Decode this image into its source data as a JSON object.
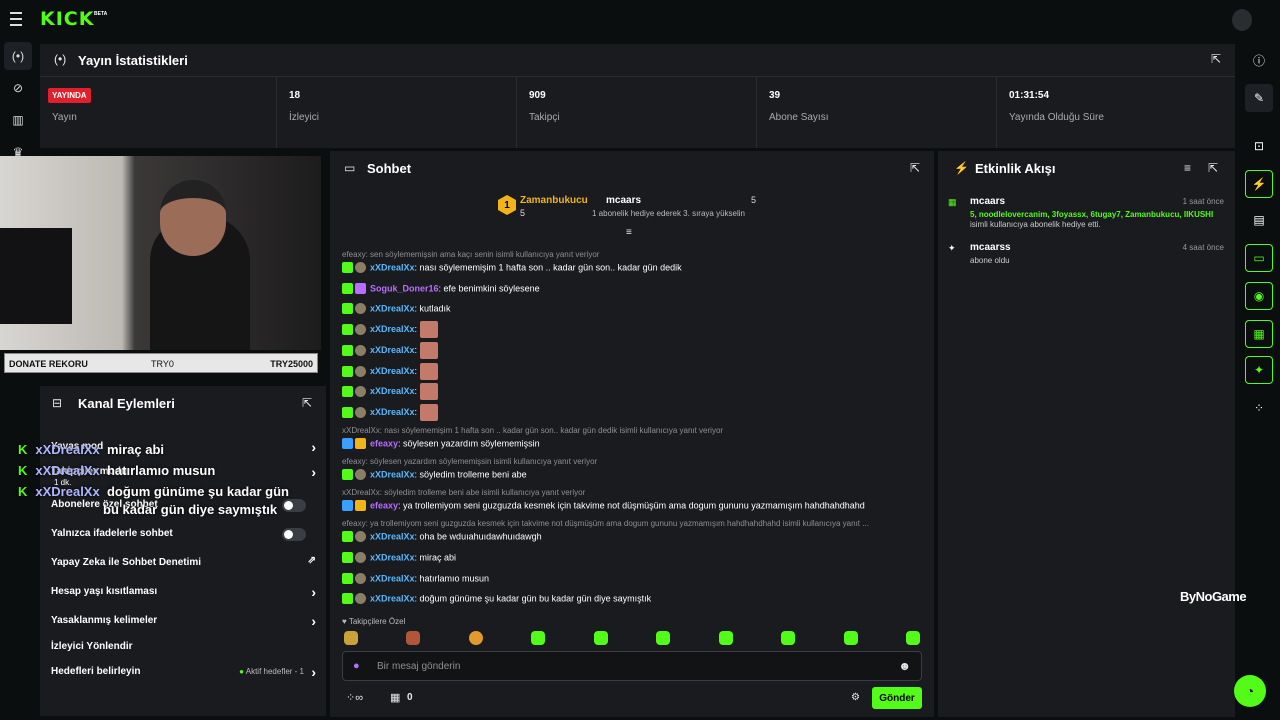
{
  "topbar": {
    "logo": "KICK",
    "beta": "BETA"
  },
  "stats": {
    "title": "Yayın İstatistikleri",
    "live_badge": "YAYINDA",
    "cells": [
      {
        "label": "Yayın"
      },
      {
        "value": "18",
        "label": "İzleyici"
      },
      {
        "value": "909",
        "label": "Takipçi"
      },
      {
        "value": "39",
        "label": "Abone Sayısı"
      },
      {
        "value": "01:31:54",
        "label": "Yayında Olduğu Süre"
      }
    ]
  },
  "donate": {
    "label": "DONATE REKORU",
    "mid": "TRY0",
    "value": "TRY25000"
  },
  "actions": {
    "title": "Kanal Eylemleri",
    "rows": [
      {
        "label": "Yavaş mod"
      },
      {
        "label": "Takipçiler modu"
      },
      {
        "label": "Abonelere özel sohbet"
      },
      {
        "label": "Yalnızca ifadelerle sohbet"
      },
      {
        "label": "Yapay Zeka ile Sohbet Denetimi"
      },
      {
        "label": "Hesap yaşı kısıtlaması"
      },
      {
        "label": "Yasaklanmış kelimeler"
      },
      {
        "label": "İzleyici Yönlendir"
      },
      {
        "label": "Hedefleri belirleyin",
        "status": "Aktif hedefler - 1"
      }
    ],
    "sub_note": "1 dk."
  },
  "overlay": [
    {
      "user": "xXDrealXx",
      "text": "miraç abi"
    },
    {
      "user": "xXDrealXx",
      "text": "hatırlamıo musun"
    },
    {
      "user": "xXDrealXx",
      "text": "doğum günüme şu kadar gün"
    },
    {
      "user": "",
      "text": "bu kadar gün diye saymıştık"
    }
  ],
  "chat": {
    "title": "Sohbet",
    "pinned": {
      "top_user": "Zamanbukucu",
      "top_rank": "1",
      "top_count": "5",
      "gift_user": "mcaars",
      "gift_count": "5",
      "gift_text": "1 abonelik hediye ederek 3. sıraya yükselin"
    },
    "messages": [
      {
        "reply": "efeaxy: sen söylememişsin ama kaçı senin isimli kullanıcıya yanıt veriyor",
        "user": "xXDrealXx",
        "text": ": nası söylememişim 1 hafta son .. kadar gün son.. kadar gün dedik"
      },
      {
        "user": "Soguk_Doner16",
        "text": ": efe benimkini söylesene"
      },
      {
        "user": "xXDrealXx",
        "text": ": kutladık"
      },
      {
        "user": "xXDrealXx",
        "text": ":"
      },
      {
        "user": "xXDrealXx",
        "text": ":"
      },
      {
        "user": "xXDrealXx",
        "text": ":"
      },
      {
        "user": "xXDrealXx",
        "text": ":"
      },
      {
        "user": "xXDrealXx",
        "text": ":"
      },
      {
        "reply": "xXDrealXx: nası söylememişim 1 hafta son .. kadar gün son.. kadar gün dedik isimli kullanıcıya yanıt veriyor",
        "user": "efeaxy",
        "text": ": söylesen yazardım söylememişsin"
      },
      {
        "reply": "efeaxy: söylesen yazardım söylememişsin isimli kullanıcıya yanıt veriyor",
        "user": "xXDrealXx",
        "text": ": söyledim trolleme beni abe"
      },
      {
        "reply": "xXDrealXx: söyledim trolleme beni abe isimli kullanıcıya yanıt veriyor",
        "user": "efeaxy",
        "text": ": ya trollemiyom seni guzguzda kesmek için takvime not düşmüşüm ama dogum gununu yazmamışım hahdhahdhahd"
      },
      {
        "reply": "efeaxy: ya trollemiyom seni guzguzda kesmek için takvime not düşmüşüm ama dogum gununu yazmamışım hahdhahdhahd isimli kullanıcıya yanıt ...",
        "user": "xXDrealXx",
        "text": ": oha be wduıahuıdawhuıdawgh"
      },
      {
        "user": "xXDrealXx",
        "text": ": miraç abi"
      },
      {
        "user": "xXDrealXx",
        "text": ": hatırlamıo musun"
      },
      {
        "user": "xXDrealXx",
        "text": ": doğum günüme şu kadar gün bu kadar gün diye saymıştık"
      }
    ],
    "followers_only": "Takipçilere Özel",
    "input_placeholder": "Bir mesaj gönderin",
    "points": "0",
    "send": "Gönder"
  },
  "activity": {
    "title": "Etkinlik Akışı",
    "items": [
      {
        "user": "mcaars",
        "time": "1 saat önce",
        "highlight": "5, noodlelovercanim, 3foyassx, 6tugay7, Zamanbukucu, IIKUSHI",
        "text": "isimli kullanıcıya abonelik hediye etti."
      },
      {
        "user": "mcaarss",
        "time": "4 saat önce",
        "text": "abone oldu"
      }
    ]
  },
  "sponsor": "ByNoGame",
  "colors": {
    "accent": "#53fc18",
    "panel": "#191b1f",
    "live": "#e0202c"
  }
}
